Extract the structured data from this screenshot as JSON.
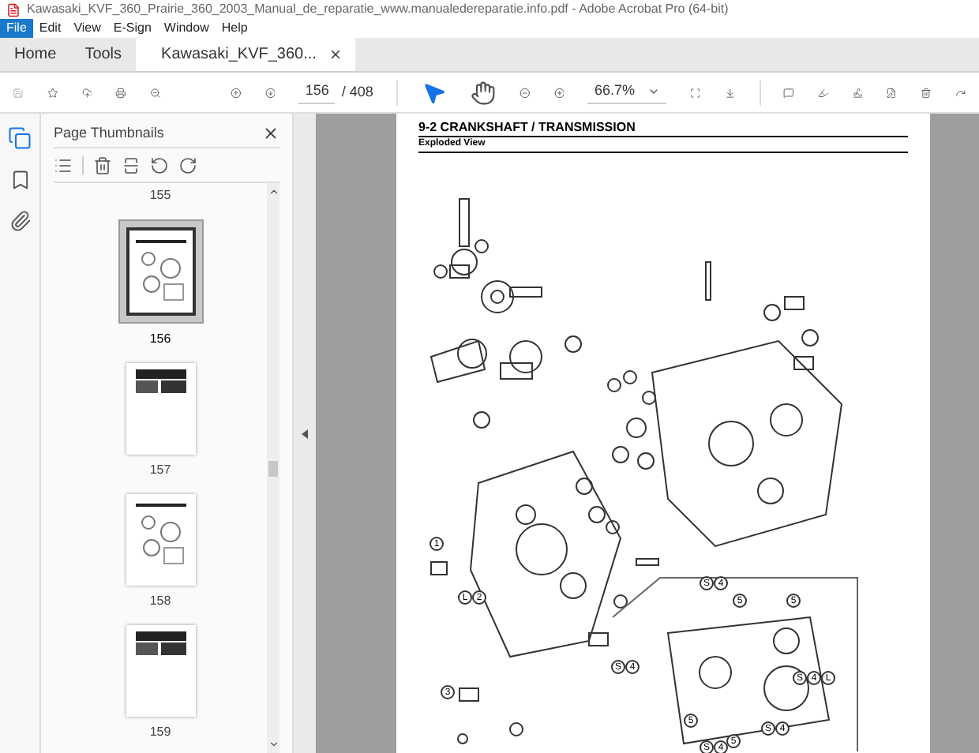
{
  "window": {
    "title": "Kawasaki_KVF_360_Prairie_360_2003_Manual_de_reparatie_www.manualedereparatie.info.pdf - Adobe Acrobat Pro (64-bit)"
  },
  "menu": [
    {
      "label": "File",
      "selected": true
    },
    {
      "label": "Edit",
      "selected": false
    },
    {
      "label": "View",
      "selected": false
    },
    {
      "label": "E-Sign",
      "selected": false
    },
    {
      "label": "Window",
      "selected": false
    },
    {
      "label": "Help",
      "selected": false
    }
  ],
  "tabs": [
    {
      "label": "Home",
      "selected": false,
      "kind": "plain"
    },
    {
      "label": "Tools",
      "selected": false,
      "kind": "plain"
    },
    {
      "label": "Kawasaki_KVF_360...",
      "selected": true,
      "kind": "document"
    }
  ],
  "toolbar": {
    "page": "156",
    "page_total": "/ 408",
    "zoom": "66.7%",
    "tools": [
      {
        "kind": "select",
        "selected": true
      },
      {
        "kind": "hand",
        "selected": false
      }
    ]
  },
  "sidebar": {
    "title": "Page Thumbnails",
    "thumbnails": [
      {
        "label": "155",
        "kind": "cut",
        "selected": false
      },
      {
        "label": "156",
        "kind": "diagram",
        "selected": true
      },
      {
        "label": "157",
        "kind": "table",
        "selected": false
      },
      {
        "label": "158",
        "kind": "diagram",
        "selected": false
      },
      {
        "label": "159",
        "kind": "table",
        "selected": false
      }
    ]
  },
  "document": {
    "heading": "9-2 CRANKSHAFT / TRANSMISSION",
    "subheading": "Exploded View",
    "callouts": [
      {
        "labels": [
          "1"
        ]
      },
      {
        "labels": [
          "L",
          "2"
        ]
      },
      {
        "labels": [
          "3"
        ]
      },
      {
        "labels": [
          "S",
          "4"
        ]
      },
      {
        "labels": [
          "5"
        ]
      },
      {
        "labels": [
          "5"
        ]
      },
      {
        "labels": [
          "S",
          "4"
        ]
      },
      {
        "labels": [
          "S",
          "4",
          "L"
        ]
      },
      {
        "labels": [
          "5"
        ]
      },
      {
        "labels": [
          "S",
          "4"
        ]
      },
      {
        "labels": [
          "S",
          "4"
        ]
      },
      {
        "labels": [
          "5"
        ]
      }
    ]
  }
}
